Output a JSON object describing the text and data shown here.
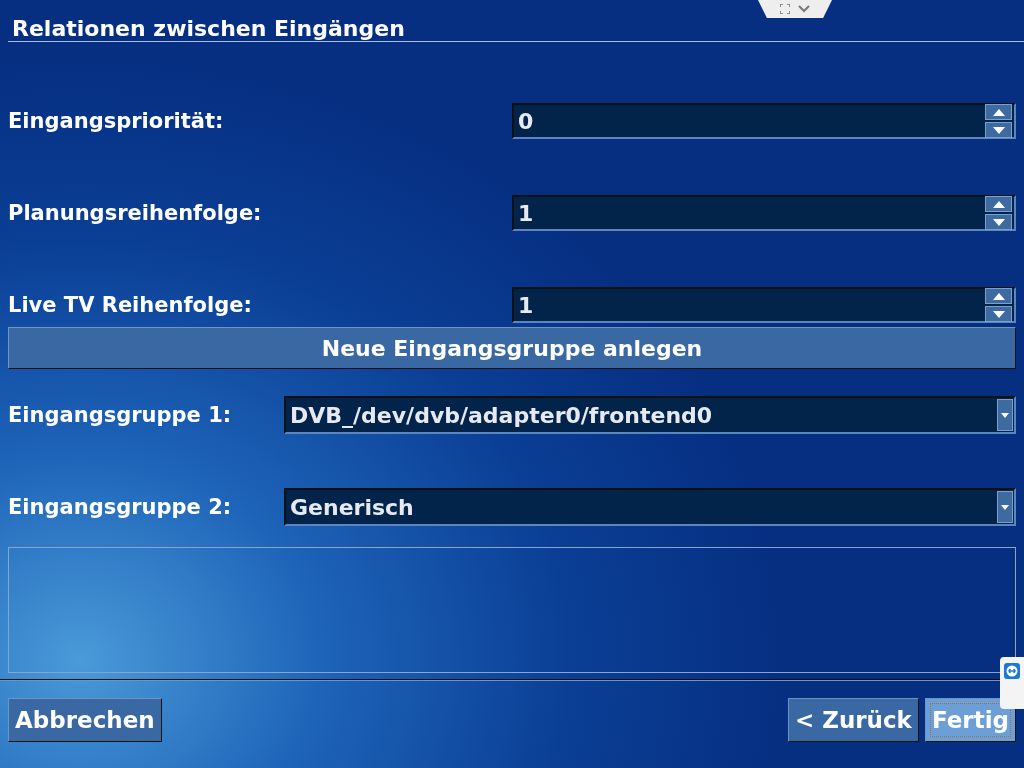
{
  "window": {
    "title": "Relationen zwischen Eingängen"
  },
  "spinboxes": [
    {
      "label": "Eingangspriorität:",
      "value": "0"
    },
    {
      "label": "Planungsreihenfolge:",
      "value": "1"
    },
    {
      "label": "Live TV Reihenfolge:",
      "value": "1"
    }
  ],
  "new_group_button": {
    "label": "Neue Eingangsgruppe anlegen"
  },
  "comboboxes": [
    {
      "label": "Eingangsgruppe 1:",
      "value": "DVB_/dev/dvb/adapter0/frontend0"
    },
    {
      "label": "Eingangsgruppe 2:",
      "value": "Generisch"
    }
  ],
  "buttons": [
    {
      "label": "Abbrechen",
      "focused": false
    },
    {
      "label": "< Zurück",
      "focused": false
    },
    {
      "label": "Fertig",
      "focused": true
    }
  ]
}
